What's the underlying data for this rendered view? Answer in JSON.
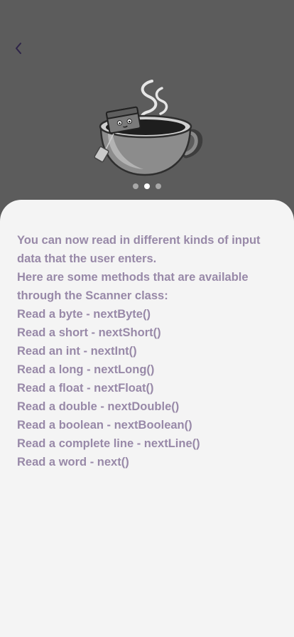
{
  "nav": {
    "back_icon": "chevron-left-icon"
  },
  "hero": {
    "icon": "coffee-cup-illustration"
  },
  "pager": {
    "total": 3,
    "active_index": 1
  },
  "lesson": {
    "lines": [
      "You can now read in different kinds of input",
      "data that the user enters.",
      "Here are some methods that are available",
      "through the Scanner class:",
      "Read a byte - nextByte()",
      "Read a short - nextShort()",
      "Read an int - nextInt()",
      "Read a long - nextLong()",
      "Read a float - nextFloat()",
      "Read a double - nextDouble()",
      "Read a boolean - nextBoolean()",
      "Read a complete line - nextLine()",
      "Read a word - next()"
    ]
  },
  "colors": {
    "header_bg": "#5c5c5c",
    "sheet_bg": "#f4f4f4",
    "text": "#9889a8",
    "back_icon": "#2e2448"
  }
}
